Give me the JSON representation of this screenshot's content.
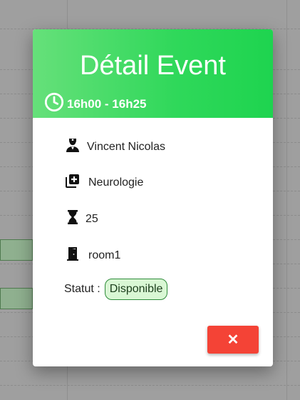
{
  "modal": {
    "title": "Détail Event",
    "time": "16h00 - 16h25",
    "doctor": "Vincent Nicolas",
    "specialty": "Neurologie",
    "duration": "25",
    "room": "room1",
    "status_label": "Statut :",
    "status_value": "Disponible",
    "close_label": "✕"
  },
  "icons": {
    "time": "clock-icon",
    "doctor": "doctor-icon",
    "specialty": "medical-plus-icon",
    "duration": "hourglass-icon",
    "room": "door-icon",
    "close": "close-icon"
  },
  "colors": {
    "header_gradient_start": "#66e07a",
    "header_gradient_end": "#1ed44f",
    "close_button": "#f44336",
    "status_badge_bg": "#d9f7d4",
    "status_badge_border": "#2e8b3a"
  }
}
